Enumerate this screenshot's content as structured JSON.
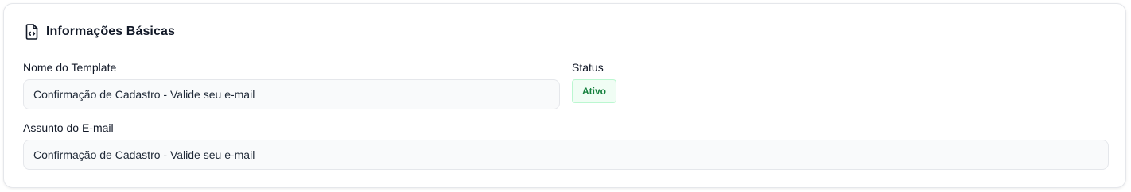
{
  "section": {
    "title": "Informações Básicas",
    "icon": "file-code-icon"
  },
  "fields": {
    "template_name": {
      "label": "Nome do Template",
      "value": "Confirmação de Cadastro - Valide seu e-mail"
    },
    "status": {
      "label": "Status",
      "value": "Ativo"
    },
    "email_subject": {
      "label": "Assunto do E-mail",
      "value": "Confirmação de Cadastro - Valide seu e-mail"
    }
  },
  "colors": {
    "status_text": "#15803d",
    "status_bg": "#f0fdf4",
    "status_border": "#bbf7d0"
  }
}
